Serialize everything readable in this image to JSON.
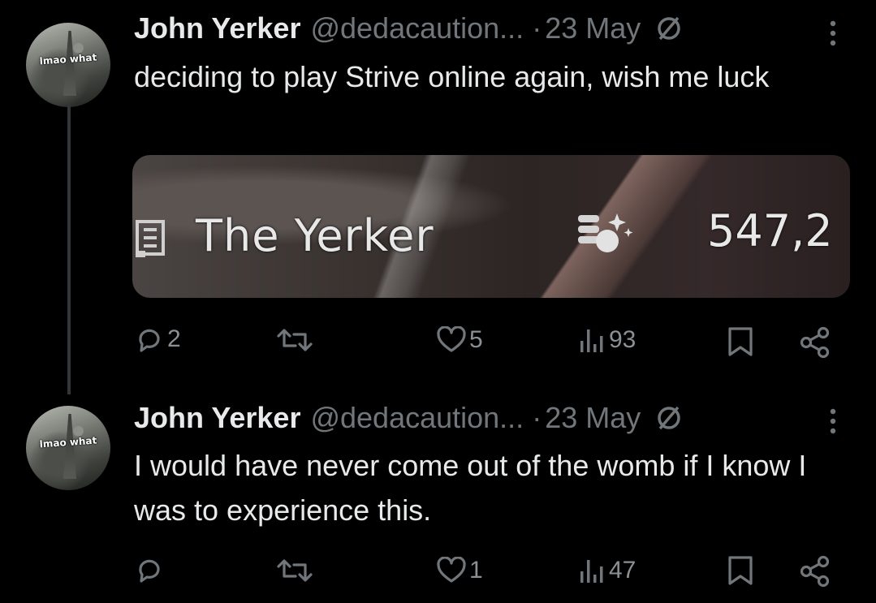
{
  "tweets": [
    {
      "avatar_caption": "lmao what",
      "name": "John Yerker",
      "handle": "@dedacaution...",
      "separator": "·",
      "date": "23 May",
      "text": "deciding to play Strive online again, wish me luck",
      "media": {
        "player_name": "The Yerker",
        "score": "547,2"
      },
      "actions": {
        "replies": "2",
        "retweets": "",
        "likes": "5",
        "views": "93"
      }
    },
    {
      "avatar_caption": "lmao what",
      "name": "John Yerker",
      "handle": "@dedacaution...",
      "separator": "·",
      "date": "23 May",
      "text": "I would have never come out of the womb if I know I was to experience this.",
      "actions": {
        "replies": "",
        "retweets": "",
        "likes": "1",
        "views": "47"
      }
    }
  ],
  "icons": [
    "no-sign-icon",
    "more-icon",
    "reply-icon",
    "retweet-icon",
    "like-icon",
    "views-icon",
    "bookmark-icon",
    "share-icon"
  ],
  "colors": {
    "background": "#000000",
    "text": "#e7e9ea",
    "muted": "#71767b",
    "thread_line": "#333639"
  }
}
